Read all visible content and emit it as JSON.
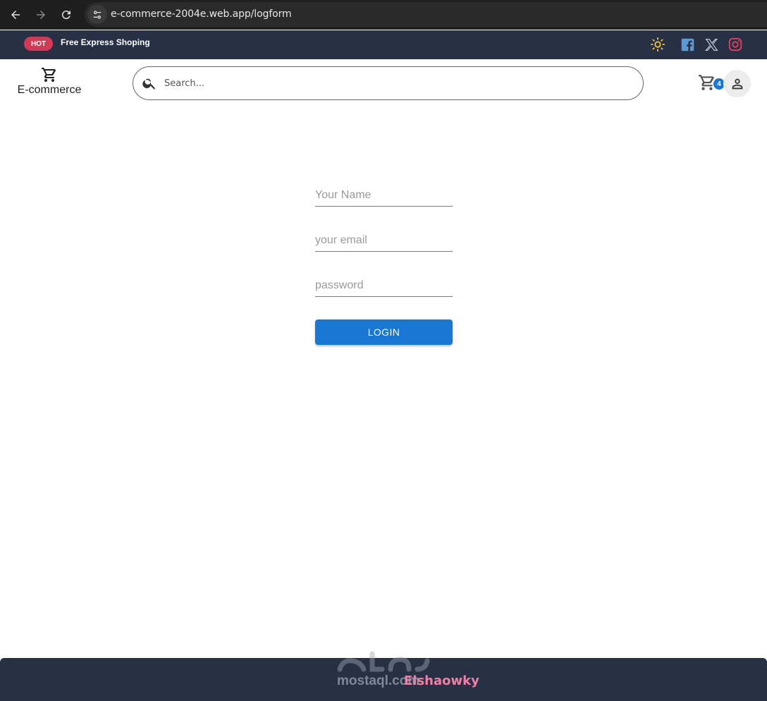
{
  "browser": {
    "url": "e-commerce-2004e.web.app/logform"
  },
  "promo": {
    "badge": "HOT",
    "text": "Free Express Shoping",
    "icons": [
      "sun-icon",
      "facebook-icon",
      "x-icon",
      "instagram-icon"
    ]
  },
  "header": {
    "logo_text": "E-commerce",
    "search_placeholder": "Search...",
    "cart_count": "4"
  },
  "form": {
    "name_placeholder": "Your Name",
    "email_placeholder": "your email",
    "password_placeholder": "password",
    "login_label": "LOGIN"
  },
  "footer": {
    "watermark": "mostaql.com",
    "name": "Elshaowky"
  },
  "colors": {
    "accent": "#1976d2",
    "bar": "#283046",
    "hot": "#d23b57",
    "footer_name": "#f07fa4"
  }
}
